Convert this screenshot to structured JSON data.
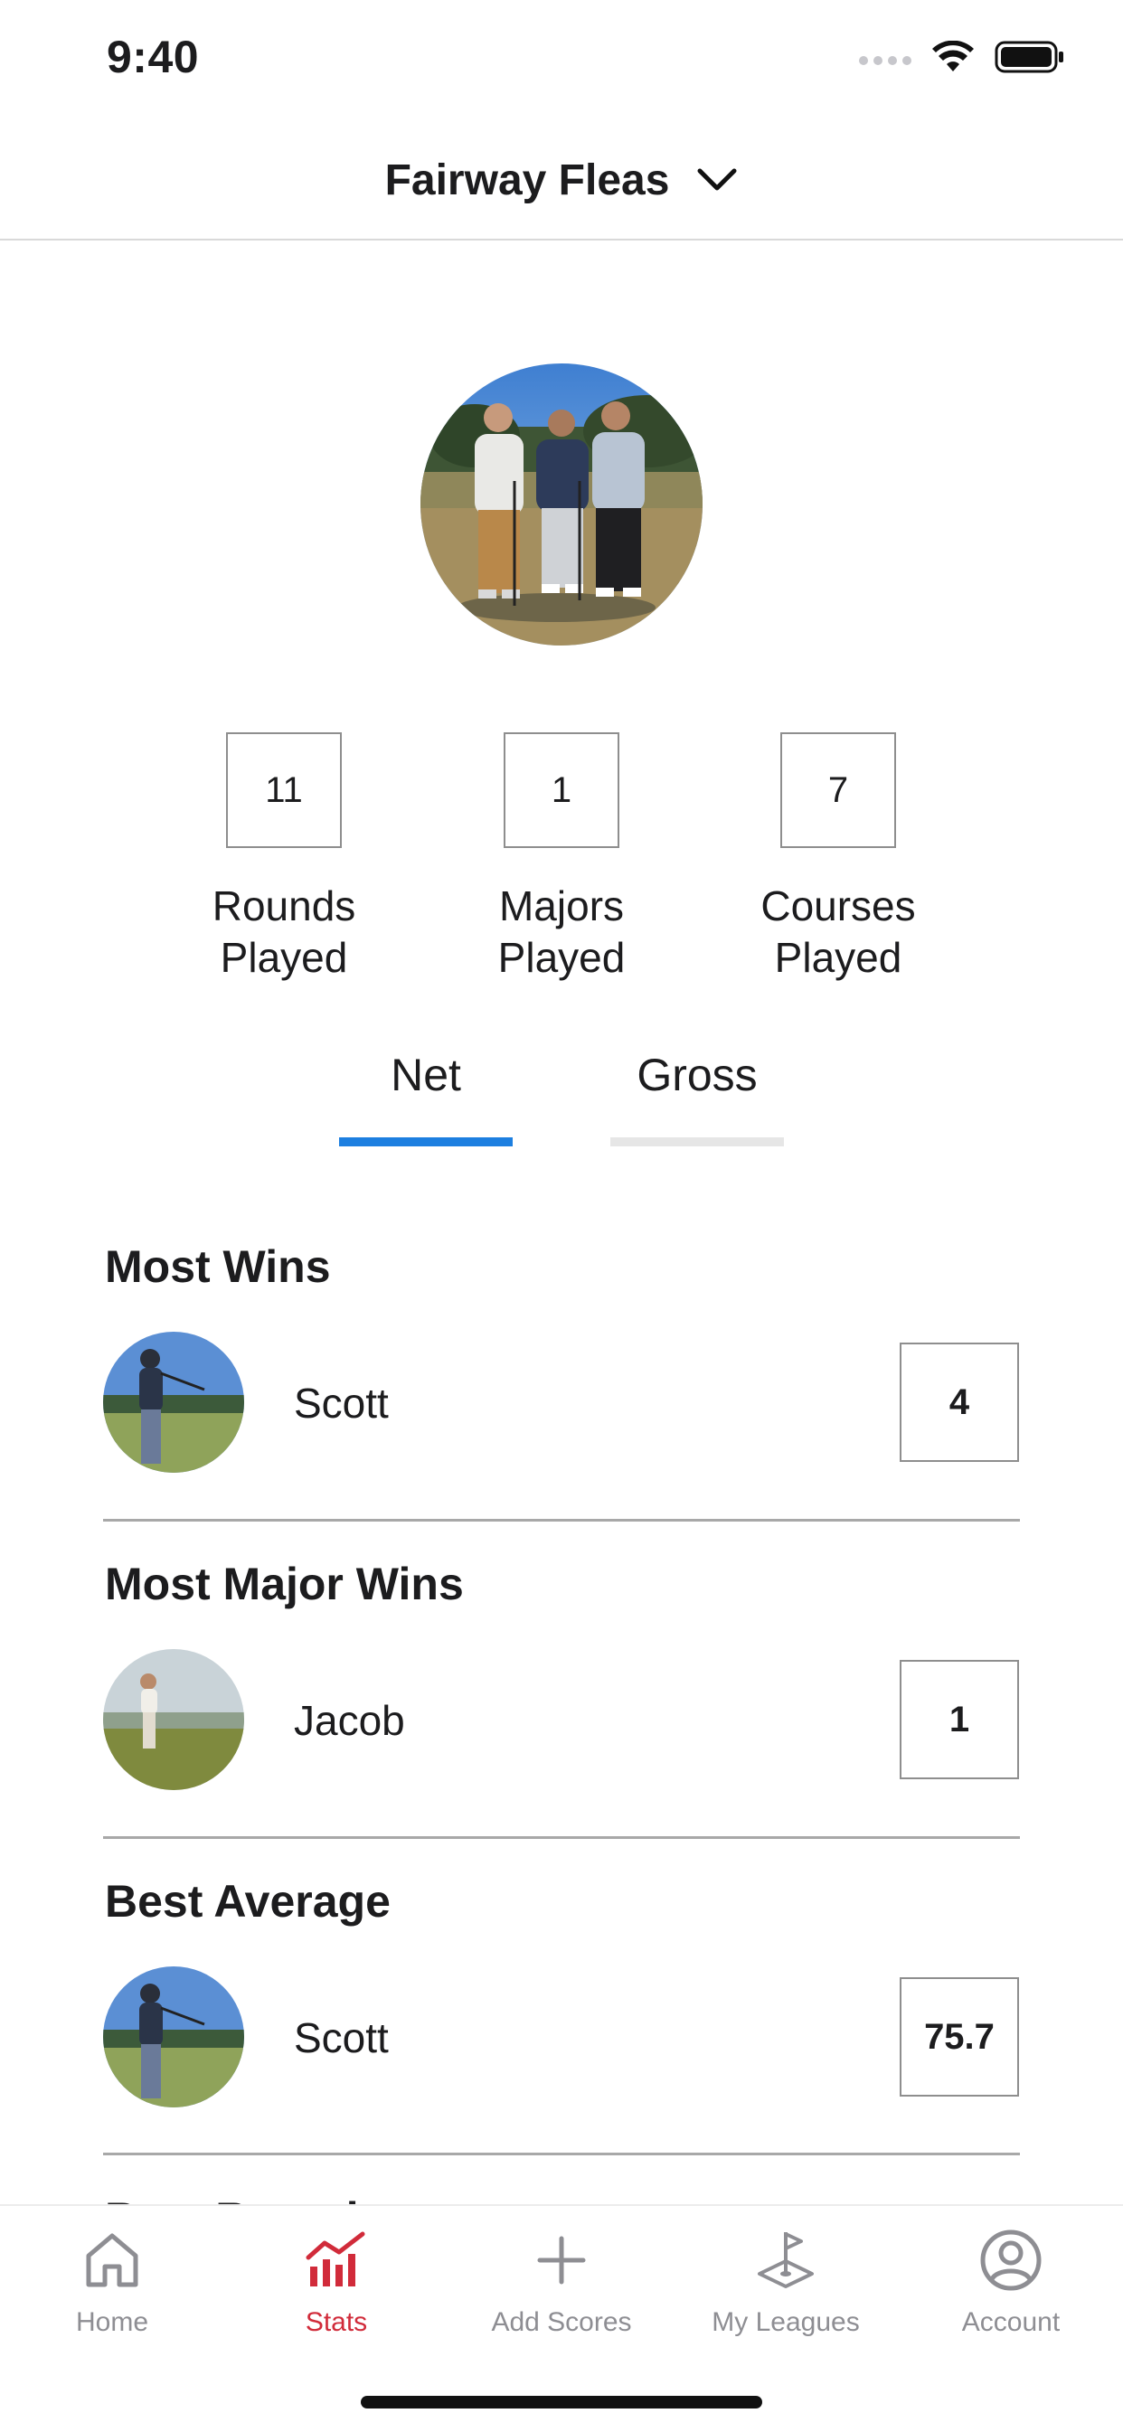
{
  "status_bar": {
    "time": "9:40",
    "icons": [
      "cellular-signal-icon",
      "wifi-icon",
      "battery-icon"
    ]
  },
  "header": {
    "title": "Fairway Fleas",
    "dropdown_icon": "chevron-down-icon"
  },
  "stats": [
    {
      "value": "11",
      "label_line1": "Rounds",
      "label_line2": "Played"
    },
    {
      "value": "1",
      "label_line1": "Majors",
      "label_line2": "Played"
    },
    {
      "value": "7",
      "label_line1": "Courses",
      "label_line2": "Played"
    }
  ],
  "tabs": {
    "net": "Net",
    "gross": "Gross",
    "selected": "Net"
  },
  "sections": [
    {
      "title": "Most Wins",
      "player": "Scott",
      "value": "4"
    },
    {
      "title": "Most Major Wins",
      "player": "Jacob",
      "value": "1"
    },
    {
      "title": "Best Average",
      "player": "Scott",
      "value": "75.7"
    },
    {
      "title": "Best Round",
      "player": "",
      "value": ""
    }
  ],
  "tab_bar": {
    "items": [
      {
        "label": "Home",
        "icon": "home-icon",
        "active": false
      },
      {
        "label": "Stats",
        "icon": "stats-icon",
        "active": true
      },
      {
        "label": "Add Scores",
        "icon": "plus-icon",
        "active": false
      },
      {
        "label": "My Leagues",
        "icon": "flag-icon",
        "active": false
      },
      {
        "label": "Account",
        "icon": "account-icon",
        "active": false
      }
    ]
  },
  "colors": {
    "accent_blue": "#1d7fe0",
    "inactive_tab_underline": "#e6e6e6",
    "active_nav": "#d12b3a",
    "inactive_nav": "#8e8e93"
  }
}
